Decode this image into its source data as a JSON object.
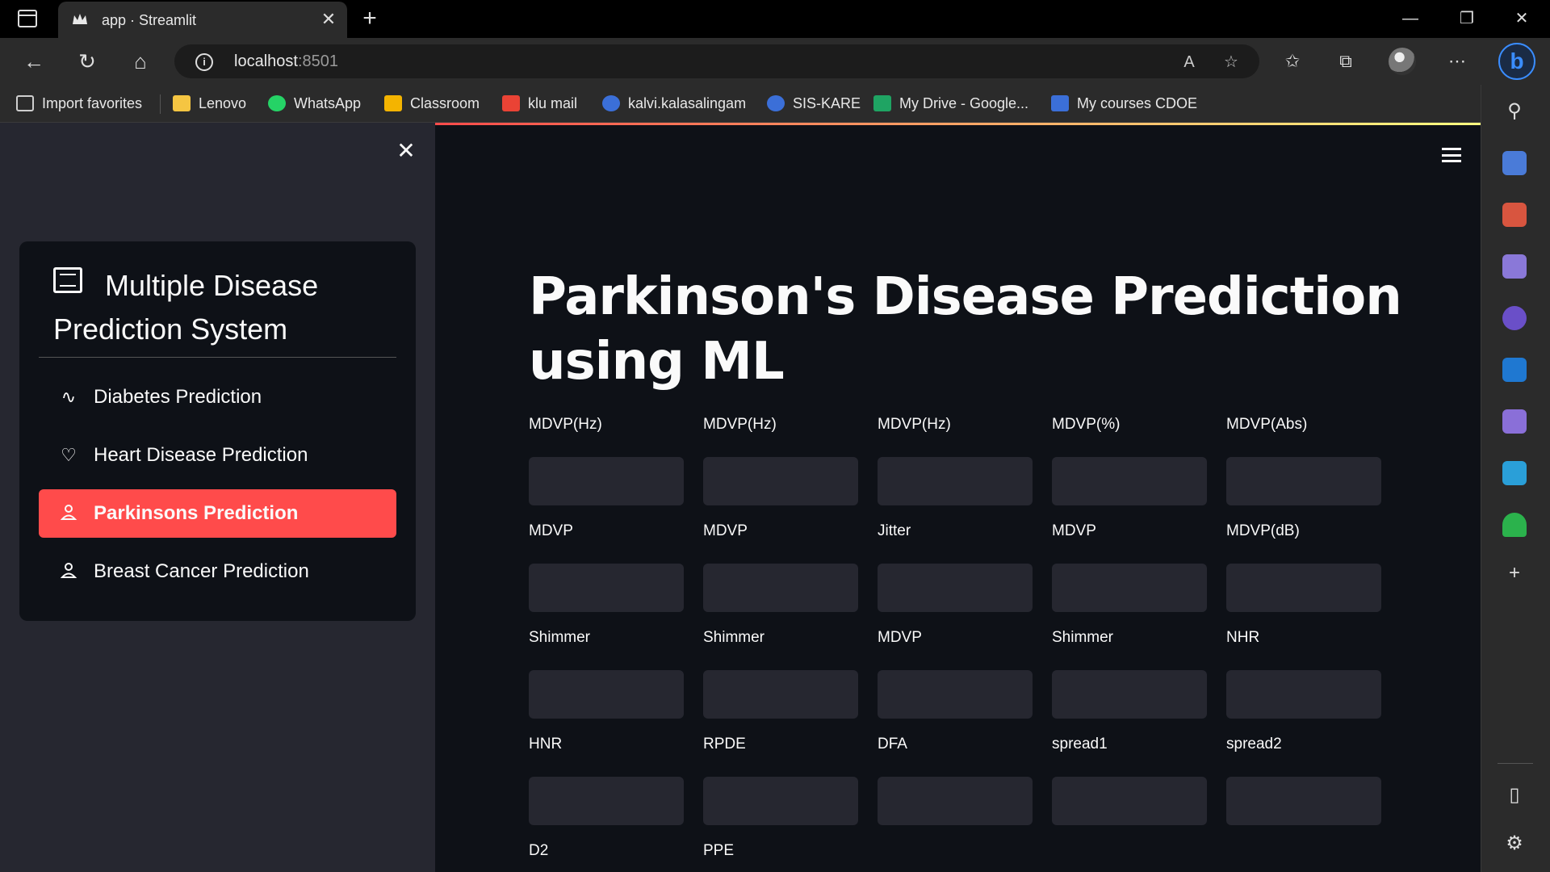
{
  "browser": {
    "tab_title": "app · Streamlit",
    "url_host": "localhost",
    "url_port": ":8501",
    "favorites": [
      {
        "label": "Import favorites",
        "color": "#cfcfcf"
      },
      {
        "label": "Lenovo",
        "color": "#f5c542"
      },
      {
        "label": "WhatsApp",
        "color": "#25d366"
      },
      {
        "label": "Classroom",
        "color": "#f4b400"
      },
      {
        "label": "klu mail",
        "color": "#ea4335"
      },
      {
        "label": "kalvi.kalasalingam",
        "color": "#3b6fd8"
      },
      {
        "label": "SIS-KARE",
        "color": "#3b6fd8"
      },
      {
        "label": "My Drive - Google...",
        "color": "#1fa463"
      },
      {
        "label": "My courses CDOE",
        "color": "#3b6fd8"
      }
    ]
  },
  "sidebar": {
    "title": "Multiple Disease Prediction System",
    "items": [
      {
        "label": "Diabetes Prediction",
        "icon": "activity-icon",
        "glyph": "∿",
        "active": false
      },
      {
        "label": "Heart Disease Prediction",
        "icon": "heart-icon",
        "glyph": "♡",
        "active": false
      },
      {
        "label": "Parkinsons Prediction",
        "icon": "person-icon",
        "glyph": "⚲",
        "active": true
      },
      {
        "label": "Breast Cancer Prediction",
        "icon": "person-icon",
        "glyph": "⚲",
        "active": false
      }
    ],
    "accent_color": "#ff4b4b"
  },
  "main": {
    "title": "Parkinson's Disease Prediction using ML",
    "fields": [
      {
        "label": "MDVP(Hz)",
        "value": ""
      },
      {
        "label": "MDVP(Hz)",
        "value": ""
      },
      {
        "label": "MDVP(Hz)",
        "value": ""
      },
      {
        "label": "MDVP(%)",
        "value": ""
      },
      {
        "label": "MDVP(Abs)",
        "value": ""
      },
      {
        "label": "MDVP",
        "value": ""
      },
      {
        "label": "MDVP",
        "value": ""
      },
      {
        "label": "Jitter",
        "value": ""
      },
      {
        "label": "MDVP",
        "value": ""
      },
      {
        "label": "MDVP(dB)",
        "value": ""
      },
      {
        "label": "Shimmer",
        "value": ""
      },
      {
        "label": "Shimmer",
        "value": ""
      },
      {
        "label": "MDVP",
        "value": ""
      },
      {
        "label": "Shimmer",
        "value": ""
      },
      {
        "label": "NHR",
        "value": ""
      },
      {
        "label": "HNR",
        "value": ""
      },
      {
        "label": "RPDE",
        "value": ""
      },
      {
        "label": "DFA",
        "value": ""
      },
      {
        "label": "spread1",
        "value": ""
      },
      {
        "label": "spread2",
        "value": ""
      },
      {
        "label": "D2",
        "value": ""
      },
      {
        "label": "PPE",
        "value": ""
      }
    ]
  }
}
